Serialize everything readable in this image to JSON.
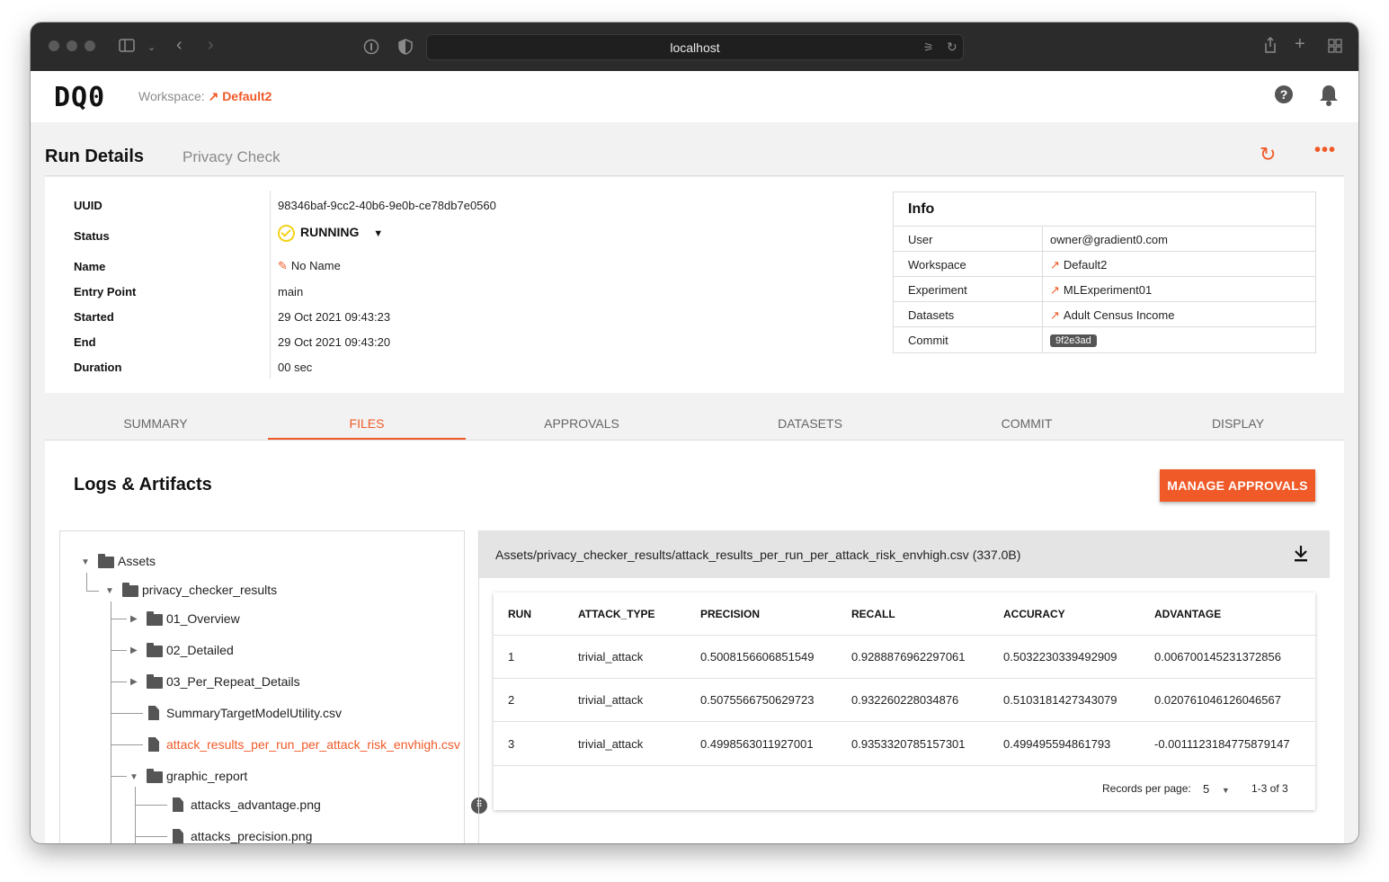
{
  "browser": {
    "url": "localhost"
  },
  "app": {
    "logo": "DQ0",
    "workspace_label": "Workspace:",
    "workspace_name": "Default2",
    "help_glyph": "?"
  },
  "header": {
    "title": "Run Details",
    "subtitle": "Privacy Check"
  },
  "details": [
    {
      "label": "UUID",
      "value": "98346baf-9cc2-40b6-9e0b-ce78db7e0560"
    },
    {
      "label": "Status",
      "value": "RUNNING"
    },
    {
      "label": "Name",
      "value": "No Name"
    },
    {
      "label": "Entry Point",
      "value": "main"
    },
    {
      "label": "Started",
      "value": "29 Oct 2021 09:43:23"
    },
    {
      "label": "End",
      "value": "29 Oct 2021 09:43:20"
    },
    {
      "label": "Duration",
      "value": "00 sec"
    }
  ],
  "info": {
    "title": "Info",
    "rows": [
      {
        "key": "User",
        "value": "owner@gradient0.com"
      },
      {
        "key": "Workspace",
        "value": "Default2"
      },
      {
        "key": "Experiment",
        "value": "MLExperiment01"
      },
      {
        "key": "Datasets",
        "value": "Adult Census Income"
      },
      {
        "key": "Commit",
        "value": "9f2e3ad"
      }
    ]
  },
  "tabs": [
    "SUMMARY",
    "FILES",
    "APPROVALS",
    "DATASETS",
    "COMMIT",
    "DISPLAY"
  ],
  "active_tab": "FILES",
  "logs": {
    "title": "Logs & Artifacts",
    "manage_button": "MANAGE APPROVALS"
  },
  "tree": {
    "assets": "Assets",
    "privacy_checker_results": "privacy_checker_results",
    "overview": "01_Overview",
    "detailed": "02_Detailed",
    "per_repeat": "03_Per_Repeat_Details",
    "summary_csv": "SummaryTargetModelUtility.csv",
    "attack_csv": "attack_results_per_run_per_attack_risk_envhigh.csv",
    "graphic_report": "graphic_report",
    "advantage_png": "attacks_advantage.png",
    "precision_png": "attacks_precision.png"
  },
  "file": {
    "path": "Assets/privacy_checker_results/attack_results_per_run_per_attack_risk_envhigh.csv (337.0B)",
    "columns": [
      "RUN",
      "ATTACK_TYPE",
      "PRECISION",
      "RECALL",
      "ACCURACY",
      "ADVANTAGE"
    ],
    "rows": [
      [
        "1",
        "trivial_attack",
        "0.5008156606851549",
        "0.9288876962297061",
        "0.5032230339492909",
        "0.006700145231372856"
      ],
      [
        "2",
        "trivial_attack",
        "0.5075566750629723",
        "0.932260228034876",
        "0.5103181427343079",
        "0.020761046126046567"
      ],
      [
        "3",
        "trivial_attack",
        "0.4998563011927001",
        "0.9353320785157301",
        "0.499495594861793",
        "-0.0011123184775879147"
      ]
    ],
    "records_label": "Records per page:",
    "records_value": "5",
    "range": "1-3 of 3"
  },
  "colors": {
    "accent": "#f05a28",
    "status_ring": "#f3d21a"
  }
}
